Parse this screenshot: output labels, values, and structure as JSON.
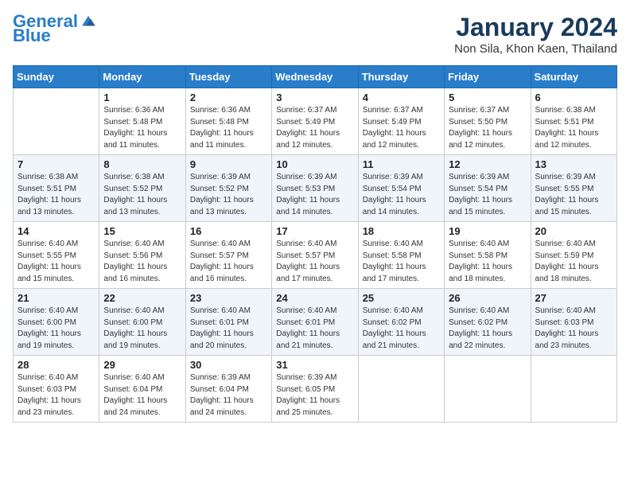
{
  "header": {
    "logo_line1": "General",
    "logo_line2": "Blue",
    "month": "January 2024",
    "location": "Non Sila, Khon Kaen, Thailand"
  },
  "days_of_week": [
    "Sunday",
    "Monday",
    "Tuesday",
    "Wednesday",
    "Thursday",
    "Friday",
    "Saturday"
  ],
  "weeks": [
    [
      {
        "day": "",
        "info": ""
      },
      {
        "day": "1",
        "info": "Sunrise: 6:36 AM\nSunset: 5:48 PM\nDaylight: 11 hours\nand 11 minutes."
      },
      {
        "day": "2",
        "info": "Sunrise: 6:36 AM\nSunset: 5:48 PM\nDaylight: 11 hours\nand 11 minutes."
      },
      {
        "day": "3",
        "info": "Sunrise: 6:37 AM\nSunset: 5:49 PM\nDaylight: 11 hours\nand 12 minutes."
      },
      {
        "day": "4",
        "info": "Sunrise: 6:37 AM\nSunset: 5:49 PM\nDaylight: 11 hours\nand 12 minutes."
      },
      {
        "day": "5",
        "info": "Sunrise: 6:37 AM\nSunset: 5:50 PM\nDaylight: 11 hours\nand 12 minutes."
      },
      {
        "day": "6",
        "info": "Sunrise: 6:38 AM\nSunset: 5:51 PM\nDaylight: 11 hours\nand 12 minutes."
      }
    ],
    [
      {
        "day": "7",
        "info": "Sunrise: 6:38 AM\nSunset: 5:51 PM\nDaylight: 11 hours\nand 13 minutes."
      },
      {
        "day": "8",
        "info": "Sunrise: 6:38 AM\nSunset: 5:52 PM\nDaylight: 11 hours\nand 13 minutes."
      },
      {
        "day": "9",
        "info": "Sunrise: 6:39 AM\nSunset: 5:52 PM\nDaylight: 11 hours\nand 13 minutes."
      },
      {
        "day": "10",
        "info": "Sunrise: 6:39 AM\nSunset: 5:53 PM\nDaylight: 11 hours\nand 14 minutes."
      },
      {
        "day": "11",
        "info": "Sunrise: 6:39 AM\nSunset: 5:54 PM\nDaylight: 11 hours\nand 14 minutes."
      },
      {
        "day": "12",
        "info": "Sunrise: 6:39 AM\nSunset: 5:54 PM\nDaylight: 11 hours\nand 15 minutes."
      },
      {
        "day": "13",
        "info": "Sunrise: 6:39 AM\nSunset: 5:55 PM\nDaylight: 11 hours\nand 15 minutes."
      }
    ],
    [
      {
        "day": "14",
        "info": "Sunrise: 6:40 AM\nSunset: 5:55 PM\nDaylight: 11 hours\nand 15 minutes."
      },
      {
        "day": "15",
        "info": "Sunrise: 6:40 AM\nSunset: 5:56 PM\nDaylight: 11 hours\nand 16 minutes."
      },
      {
        "day": "16",
        "info": "Sunrise: 6:40 AM\nSunset: 5:57 PM\nDaylight: 11 hours\nand 16 minutes."
      },
      {
        "day": "17",
        "info": "Sunrise: 6:40 AM\nSunset: 5:57 PM\nDaylight: 11 hours\nand 17 minutes."
      },
      {
        "day": "18",
        "info": "Sunrise: 6:40 AM\nSunset: 5:58 PM\nDaylight: 11 hours\nand 17 minutes."
      },
      {
        "day": "19",
        "info": "Sunrise: 6:40 AM\nSunset: 5:58 PM\nDaylight: 11 hours\nand 18 minutes."
      },
      {
        "day": "20",
        "info": "Sunrise: 6:40 AM\nSunset: 5:59 PM\nDaylight: 11 hours\nand 18 minutes."
      }
    ],
    [
      {
        "day": "21",
        "info": "Sunrise: 6:40 AM\nSunset: 6:00 PM\nDaylight: 11 hours\nand 19 minutes."
      },
      {
        "day": "22",
        "info": "Sunrise: 6:40 AM\nSunset: 6:00 PM\nDaylight: 11 hours\nand 19 minutes."
      },
      {
        "day": "23",
        "info": "Sunrise: 6:40 AM\nSunset: 6:01 PM\nDaylight: 11 hours\nand 20 minutes."
      },
      {
        "day": "24",
        "info": "Sunrise: 6:40 AM\nSunset: 6:01 PM\nDaylight: 11 hours\nand 21 minutes."
      },
      {
        "day": "25",
        "info": "Sunrise: 6:40 AM\nSunset: 6:02 PM\nDaylight: 11 hours\nand 21 minutes."
      },
      {
        "day": "26",
        "info": "Sunrise: 6:40 AM\nSunset: 6:02 PM\nDaylight: 11 hours\nand 22 minutes."
      },
      {
        "day": "27",
        "info": "Sunrise: 6:40 AM\nSunset: 6:03 PM\nDaylight: 11 hours\nand 23 minutes."
      }
    ],
    [
      {
        "day": "28",
        "info": "Sunrise: 6:40 AM\nSunset: 6:03 PM\nDaylight: 11 hours\nand 23 minutes."
      },
      {
        "day": "29",
        "info": "Sunrise: 6:40 AM\nSunset: 6:04 PM\nDaylight: 11 hours\nand 24 minutes."
      },
      {
        "day": "30",
        "info": "Sunrise: 6:39 AM\nSunset: 6:04 PM\nDaylight: 11 hours\nand 24 minutes."
      },
      {
        "day": "31",
        "info": "Sunrise: 6:39 AM\nSunset: 6:05 PM\nDaylight: 11 hours\nand 25 minutes."
      },
      {
        "day": "",
        "info": ""
      },
      {
        "day": "",
        "info": ""
      },
      {
        "day": "",
        "info": ""
      }
    ]
  ]
}
